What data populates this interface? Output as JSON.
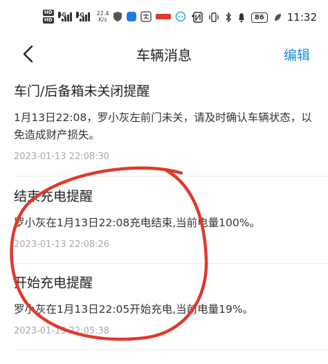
{
  "statusbar": {
    "hd1": "HD",
    "hd2": "HD",
    "gen1": "4G",
    "gen2": "4G",
    "speed_value": "22.4",
    "speed_unit": "K/s",
    "battery": "86",
    "time": "11:32"
  },
  "nav": {
    "title": "车辆消息",
    "edit_label": "编辑"
  },
  "messages": [
    {
      "title": "车门/后备箱未关闭提醒",
      "body": "1月13日22:08，罗小灰左前门未关，请及时确认车辆状态，以免造成财产损失。",
      "time": "2023-01-13 22:08:30"
    },
    {
      "title": "结束充电提醒",
      "body": "罗小灰在1月13日22:08充电结束,当前电量100%。",
      "time": "2023-01-13 22:08:26"
    },
    {
      "title": "开始充电提醒",
      "body": "罗小灰在1月13日22:05开始充电,当前电量19%。",
      "time": "2023-01-13 22:05:38"
    }
  ],
  "colors": {
    "accent": "#1a8ed6",
    "annotation": "#e03a2a"
  }
}
